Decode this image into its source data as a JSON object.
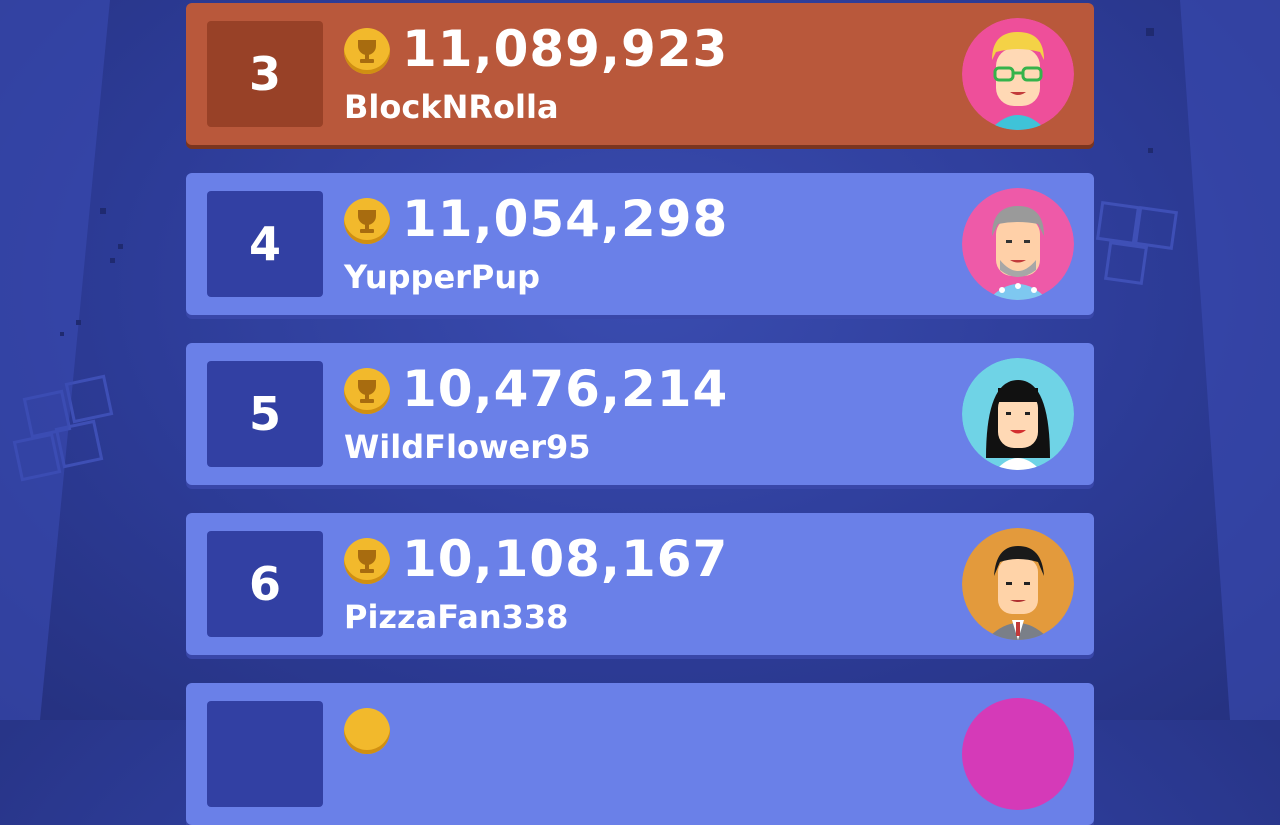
{
  "leaderboard": {
    "entries": [
      {
        "rank": "3",
        "score": "11,089,923",
        "name": "BlockNRolla",
        "avatar": "avatar-blond-glasses"
      },
      {
        "rank": "4",
        "score": "11,054,298",
        "name": "YupperPup",
        "avatar": "avatar-grey-beard"
      },
      {
        "rank": "5",
        "score": "10,476,214",
        "name": "WildFlower95",
        "avatar": "avatar-black-hair-woman"
      },
      {
        "rank": "6",
        "score": "10,108,167",
        "name": "PizzaFan338",
        "avatar": "avatar-suit-man"
      }
    ],
    "icons": {
      "score": "trophy-icon"
    },
    "colors": {
      "highlight": "#b9583b",
      "row": "#6a80e8",
      "background": "#2d3c98",
      "trophy": "#f2b92c"
    }
  }
}
